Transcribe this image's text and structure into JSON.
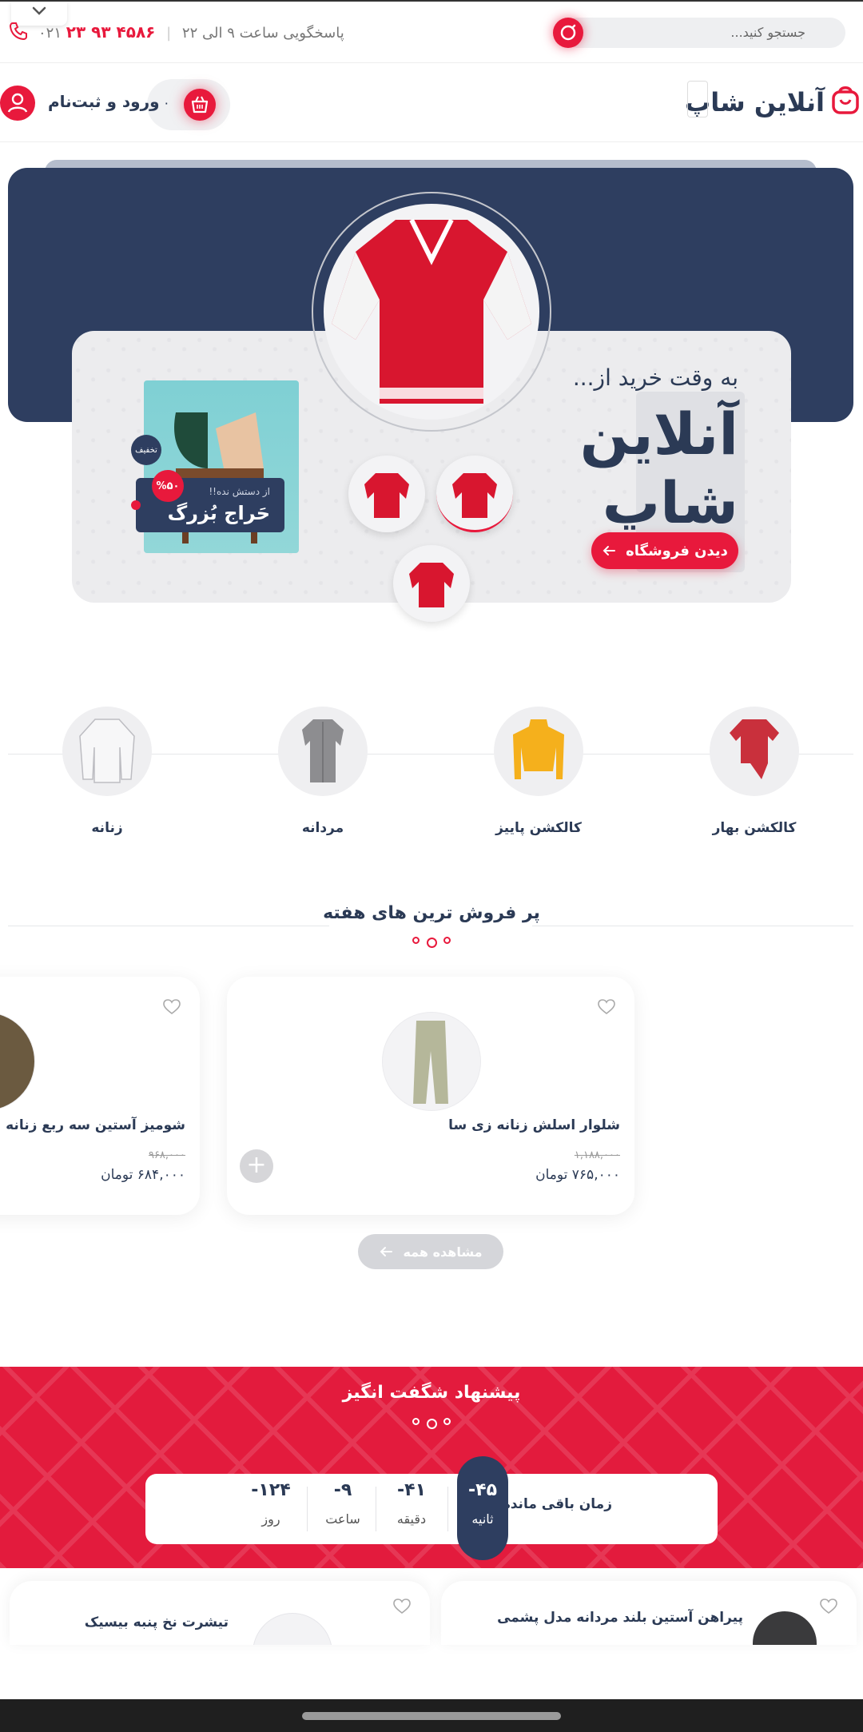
{
  "topbar": {
    "search_placeholder": "جستجو کنید...",
    "support_text": "پاسخگویی ساعت ۹ الی ۲۲",
    "phone_code": "۰۲۱",
    "phone_number": "۴۵۸۶ ۹۳ ۲۳",
    "icons": [
      "search-icon",
      "phone-icon",
      "chevron-down-icon"
    ]
  },
  "header": {
    "logo_text": "آنلاین شاپ",
    "cart_count": "۰",
    "login_label": "ورود و ثبت‌نام",
    "icons": [
      "logo-bag-icon",
      "basket-icon",
      "user-icon"
    ]
  },
  "hero": {
    "subtitle": "به وقت خرید از...",
    "title_line1": "آنلاین",
    "title_line2": "شاپ",
    "button_label": "دیدن فروشگاه",
    "promo_small": "از دستش نده!!",
    "promo_big": "حَراج بُزرگ",
    "promo_badge": "%۵۰",
    "discount_chip": "تخفیف"
  },
  "categories": [
    {
      "label": "کالکشن بهار",
      "icon": "red-blouse"
    },
    {
      "label": "کالکشن پاییز",
      "icon": "yellow-sweater"
    },
    {
      "label": "مردانه",
      "icon": "gray-shirt"
    },
    {
      "label": "زنانه",
      "icon": "white-jacket"
    }
  ],
  "bestsellers": {
    "title": "پر فروش ترین های هفته",
    "products": [
      {
        "name": "شلوار اسلش زنانه زی سا",
        "old_price": "۱,۱۸۸,۰۰۰",
        "price": "۷۶۵,۰۰۰ تومان"
      },
      {
        "name": "شومیز آستین سه ربع زنانه",
        "old_price": "۹۶۸,۰۰۰",
        "price": "۶۸۴,۰۰۰ تومان"
      }
    ],
    "see_all_label": "مشاهده همه"
  },
  "offer": {
    "title": "پیشنهاد شگفت انگیز",
    "timer_label": "زمان باقی مانده:",
    "timer": [
      {
        "value": "۴۵-",
        "unit": "ثانیه"
      },
      {
        "value": "۴۱-",
        "unit": "دقیقه"
      },
      {
        "value": "۹-",
        "unit": "ساعت"
      },
      {
        "value": "۱۲۴-",
        "unit": "روز"
      }
    ],
    "products": [
      {
        "name": "پیراهن آستین بلند مردانه مدل پشمی"
      },
      {
        "name": "تیشرت نخ پنبه بیسیک"
      }
    ]
  },
  "colors": {
    "accent": "#e8193c",
    "navy": "#2e3e60"
  }
}
